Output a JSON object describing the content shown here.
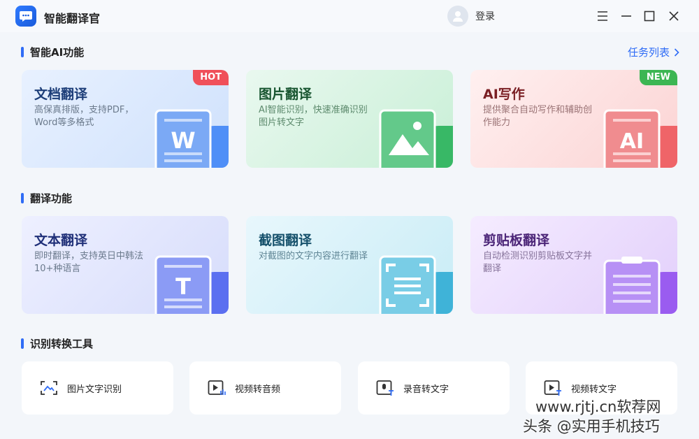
{
  "app": {
    "title": "智能翻译官"
  },
  "header": {
    "login_label": "登录"
  },
  "window_controls": [
    "menu-icon",
    "minimize-icon",
    "maximize-icon",
    "close-icon"
  ],
  "sections": {
    "ai": {
      "title": "智能AI功能",
      "task_link": "任务列表"
    },
    "translate": {
      "title": "翻译功能"
    },
    "tools": {
      "title": "识别转换工具"
    }
  },
  "ai_cards": [
    {
      "title": "文档翻译",
      "desc": "高保真排版，支持PDF，Word等多格式",
      "badge": "HOT",
      "glyph": "W"
    },
    {
      "title": "图片翻译",
      "desc": "AI智能识别，快速准确识别图片转文字"
    },
    {
      "title": "AI写作",
      "desc": "提供聚合自动写作和辅助创作能力",
      "badge": "NEW",
      "glyph": "AI"
    }
  ],
  "translate_cards": [
    {
      "title": "文本翻译",
      "desc": "即时翻译，支持英日中韩法10+种语言",
      "glyph": "T"
    },
    {
      "title": "截图翻译",
      "desc": "对截图的文字内容进行翻译"
    },
    {
      "title": "剪贴板翻译",
      "desc": "自动检测识别剪贴板文字并翻译"
    }
  ],
  "tools": [
    {
      "label": "图片文字识别",
      "icon": "image-scan-icon"
    },
    {
      "label": "视频转音频",
      "icon": "video-audio-icon"
    },
    {
      "label": "录音转文字",
      "icon": "voice-text-icon"
    },
    {
      "label": "视频转文字",
      "icon": "video-text-icon"
    }
  ],
  "colors": {
    "accent": "#2f6cf6",
    "hot": "#f0505a",
    "new": "#3cb653"
  },
  "watermark": {
    "line1": "www.rjtj.cn软荐网",
    "line2": "头条 @实用手机技巧"
  }
}
